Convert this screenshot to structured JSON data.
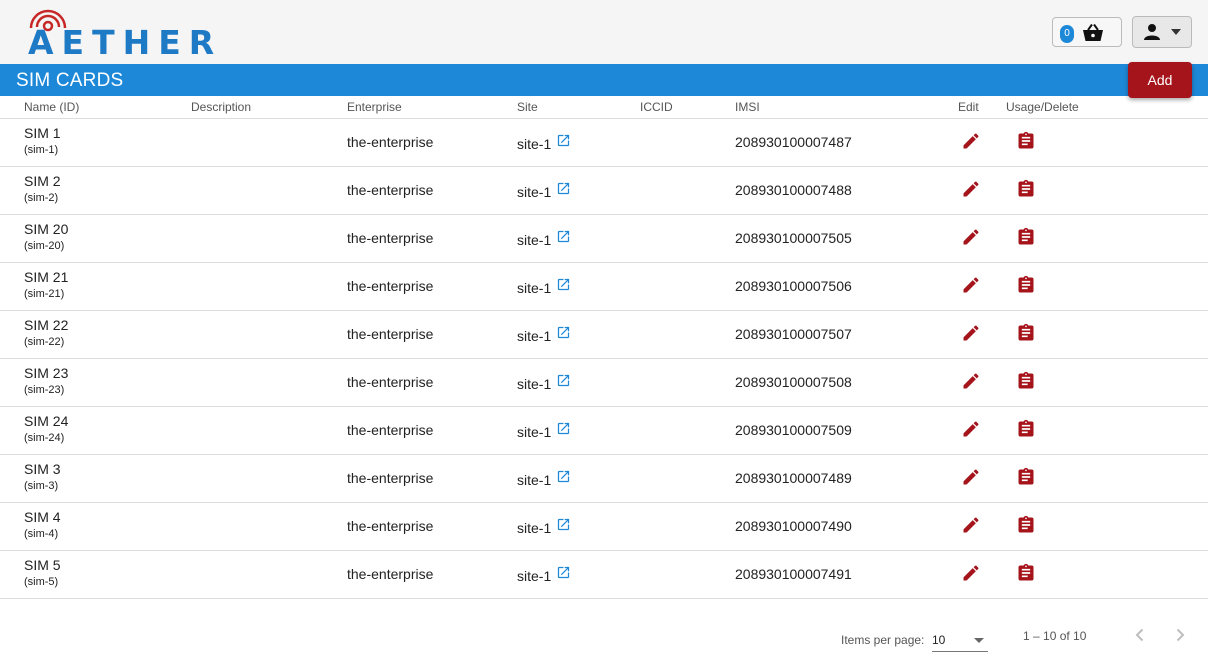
{
  "header": {
    "logo_text": "AETHER",
    "cart_count": "0",
    "cart_icon": "basket-icon",
    "user_icon": "person-icon"
  },
  "title": "SIM CARDS",
  "add_label": "Add",
  "columns": [
    "Name (ID)",
    "Description",
    "Enterprise",
    "Site",
    "ICCID",
    "IMSI",
    "Edit",
    "Usage/Delete"
  ],
  "rows": [
    {
      "name": "SIM 1",
      "id": "(sim-1)",
      "description": "",
      "enterprise": "the-enterprise",
      "site": "site-1",
      "iccid": "",
      "imsi": "208930100007487"
    },
    {
      "name": "SIM 2",
      "id": "(sim-2)",
      "description": "",
      "enterprise": "the-enterprise",
      "site": "site-1",
      "iccid": "",
      "imsi": "208930100007488"
    },
    {
      "name": "SIM 20",
      "id": "(sim-20)",
      "description": "",
      "enterprise": "the-enterprise",
      "site": "site-1",
      "iccid": "",
      "imsi": "208930100007505"
    },
    {
      "name": "SIM 21",
      "id": "(sim-21)",
      "description": "",
      "enterprise": "the-enterprise",
      "site": "site-1",
      "iccid": "",
      "imsi": "208930100007506"
    },
    {
      "name": "SIM 22",
      "id": "(sim-22)",
      "description": "",
      "enterprise": "the-enterprise",
      "site": "site-1",
      "iccid": "",
      "imsi": "208930100007507"
    },
    {
      "name": "SIM 23",
      "id": "(sim-23)",
      "description": "",
      "enterprise": "the-enterprise",
      "site": "site-1",
      "iccid": "",
      "imsi": "208930100007508"
    },
    {
      "name": "SIM 24",
      "id": "(sim-24)",
      "description": "",
      "enterprise": "the-enterprise",
      "site": "site-1",
      "iccid": "",
      "imsi": "208930100007509"
    },
    {
      "name": "SIM 3",
      "id": "(sim-3)",
      "description": "",
      "enterprise": "the-enterprise",
      "site": "site-1",
      "iccid": "",
      "imsi": "208930100007489"
    },
    {
      "name": "SIM 4",
      "id": "(sim-4)",
      "description": "",
      "enterprise": "the-enterprise",
      "site": "site-1",
      "iccid": "",
      "imsi": "208930100007490"
    },
    {
      "name": "SIM 5",
      "id": "(sim-5)",
      "description": "",
      "enterprise": "the-enterprise",
      "site": "site-1",
      "iccid": "",
      "imsi": "208930100007491"
    }
  ],
  "row_icons": {
    "site_link": "open-in-new-icon",
    "edit": "pencil-icon",
    "usage": "clipboard-icon"
  },
  "paginator": {
    "items_per_page_label": "Items per page:",
    "items_per_page": "10",
    "range": "1 – 10 of 10"
  },
  "colors": {
    "primary": "#1e88d8",
    "accent": "#a5141a",
    "topbar": "#f5f5f5"
  }
}
